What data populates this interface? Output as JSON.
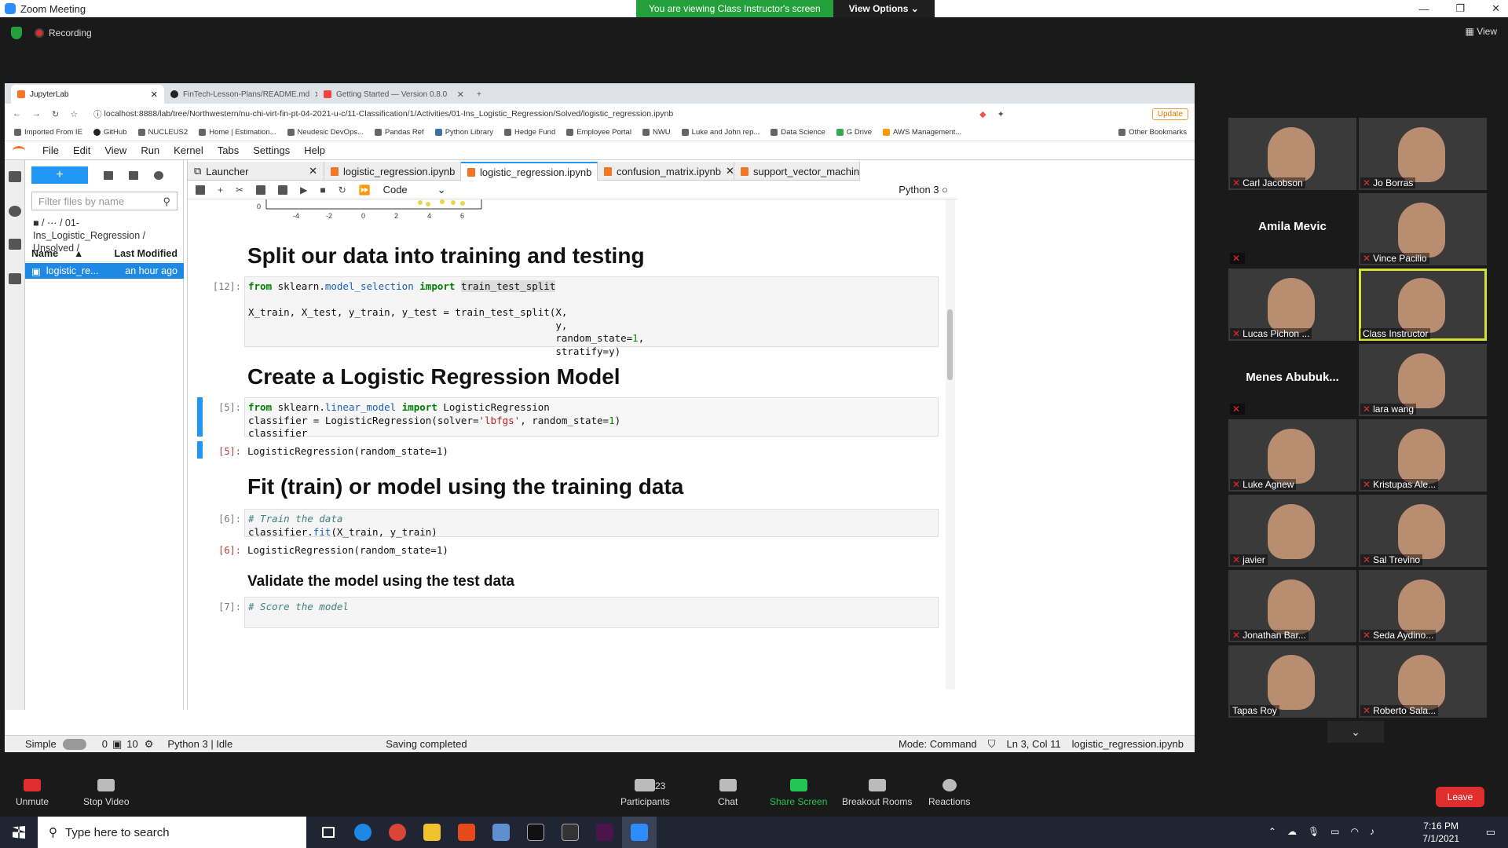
{
  "zoom": {
    "title": "Zoom Meeting",
    "banner": "You are viewing Class Instructor's screen",
    "view_options": "View Options",
    "recording": "Recording",
    "view": "View",
    "controls": {
      "unmute": "Unmute",
      "stop_video": "Stop Video",
      "participants": "Participants",
      "participants_count": "23",
      "chat": "Chat",
      "share_screen": "Share Screen",
      "breakout": "Breakout Rooms",
      "reactions": "Reactions",
      "leave": "Leave"
    },
    "participants": [
      "Carl Jacobson",
      "Jo Borras",
      "Amila Mevic",
      "Vince Pacilio",
      "Lucas Pichon ...",
      "Class Instructor",
      "Menes Abubuk...",
      "lara wang",
      "Luke Agnew",
      "Kristupas Ale...",
      "javier",
      "Sal Trevino",
      "Jonathan Bar...",
      "Seda Aydino...",
      "Tapas Roy",
      "Roberto Sala..."
    ]
  },
  "browser": {
    "tabs": [
      "JupyterLab",
      "FinTech-Lesson-Plans/README.md",
      "Getting Started — Version 0.8.0"
    ],
    "url": "localhost:8888/lab/tree/Northwestern/nu-chi-virt-fin-pt-04-2021-u-c/11-Classification/1/Activities/01-Ins_Logistic_Regression/Solved/logistic_regression.ipynb",
    "update": "Update",
    "bookmarks": [
      "Imported From IE",
      "GitHub",
      "NUCLEUS2",
      "Home | Estimation...",
      "Neudesic DevOps...",
      "Pandas Ref",
      "Python Library",
      "Hedge Fund",
      "Employee Portal",
      "NWU",
      "Luke and John rep...",
      "Data Science",
      "G Drive",
      "AWS Management...",
      "Other Bookmarks"
    ]
  },
  "jupyter": {
    "menu": [
      "File",
      "Edit",
      "View",
      "Run",
      "Kernel",
      "Tabs",
      "Settings",
      "Help"
    ],
    "filter_placeholder": "Filter files by name",
    "breadcrumb": "/ ⋯ / 01-Ins_Logistic_Regression / Unsolved /",
    "col_name": "Name",
    "col_modified": "Last Modified",
    "file_name": "logistic_re...",
    "file_modified": "an hour ago",
    "doc_tabs": [
      "Launcher",
      "logistic_regression.ipynb",
      "logistic_regression.ipynb",
      "confusion_matrix.ipynb",
      "support_vector_machine.ipynb"
    ],
    "cell_type": "Code",
    "kernel": "Python 3",
    "axis_ticks": [
      "-4",
      "-2",
      "0",
      "2",
      "4",
      "6"
    ],
    "axis_zero": "0",
    "h_split": "Split our data into training and testing",
    "p12": "[12]:",
    "h_model": "Create a Logistic Regression Model",
    "p5": "[5]:",
    "out5": "LogisticRegression(random_state=1)",
    "h_fit": "Fit (train) or model using the training data",
    "p6": "[6]:",
    "out6": "LogisticRegression(random_state=1)",
    "h_validate": "Validate the model using the test data",
    "p7": "[7]:",
    "status": {
      "mode": "Simple",
      "n1": "0",
      "n2": "10",
      "kernel": "Python 3 | Idle",
      "saving": "Saving completed",
      "cmd": "Mode: Command",
      "pos": "Ln 3, Col 11",
      "file": "logistic_regression.ipynb"
    }
  },
  "taskbar": {
    "search": "Type here to search",
    "time": "7:16 PM",
    "date": "7/1/2021"
  }
}
